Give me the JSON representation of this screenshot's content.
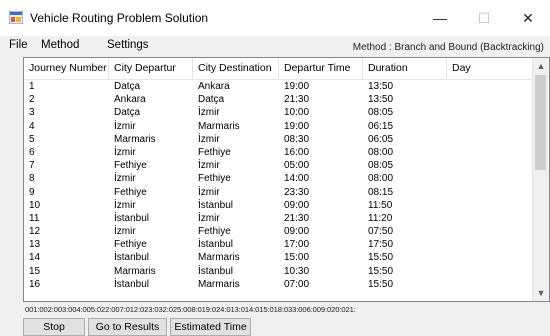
{
  "window": {
    "title": "Vehicle Routing Problem Solution",
    "minimize_glyph": "—",
    "maximize_glyph": "☐",
    "close_glyph": "✕"
  },
  "menu": {
    "file": "File",
    "method": "Method",
    "settings": "Settings"
  },
  "method_label": "Method : Branch and Bound (Backtracking)",
  "table": {
    "columns": [
      "Journey Number",
      "City Departur",
      "City Destination",
      "Departur Time",
      "Duration",
      "Day"
    ],
    "rows": [
      [
        "1",
        "Datça",
        "Ankara",
        "19:00",
        "13:50",
        ""
      ],
      [
        "2",
        "Ankara",
        "Datça",
        "21:30",
        "13:50",
        ""
      ],
      [
        "3",
        "Datça",
        "İzmir",
        "10:00",
        "08:05",
        ""
      ],
      [
        "4",
        "İzmir",
        "Marmaris",
        "19:00",
        "06:15",
        ""
      ],
      [
        "5",
        "Marmaris",
        "İzmir",
        "08:30",
        "06:05",
        ""
      ],
      [
        "6",
        "İzmir",
        "Fethiye",
        "16:00",
        "08:00",
        ""
      ],
      [
        "7",
        "Fethiye",
        "İzmir",
        "05:00",
        "08:05",
        ""
      ],
      [
        "8",
        "İzmir",
        "Fethiye",
        "14:00",
        "08:00",
        ""
      ],
      [
        "9",
        "Fethiye",
        "İzmir",
        "23:30",
        "08:15",
        ""
      ],
      [
        "10",
        "İzmir",
        "İstanbul",
        "09:00",
        "11:50",
        ""
      ],
      [
        "11",
        "İstanbul",
        "İzmir",
        "21:30",
        "11:20",
        ""
      ],
      [
        "12",
        "İzmir",
        "Fethiye",
        "09:00",
        "07:50",
        ""
      ],
      [
        "13",
        "Fethiye",
        "İstanbul",
        "17:00",
        "17:50",
        ""
      ],
      [
        "14",
        "İstanbul",
        "Marmaris",
        "15:00",
        "15:50",
        ""
      ],
      [
        "15",
        "Marmaris",
        "İstanbul",
        "10:30",
        "15:50",
        ""
      ],
      [
        "16",
        "İstanbul",
        "Marmaris",
        "07:00",
        "15:50",
        ""
      ]
    ]
  },
  "status_text": "001:002:003:004:005:022:007:012:023:032:025:008:019:024:013:014:015:018:033:006:009:020:021:",
  "buttons": {
    "stop": "Stop",
    "go_to_results": "Go to Results",
    "estimated_time": "Estimated Time"
  },
  "colors": {
    "window_bg": "#f0f0f0",
    "grid_bg": "#ffffff",
    "button_bg": "#e1e1e1",
    "scroll_thumb": "#cdcdcd"
  },
  "icons": {
    "app": "app-icon",
    "scroll_up": "chevron-up-icon",
    "scroll_down": "chevron-down-icon"
  }
}
